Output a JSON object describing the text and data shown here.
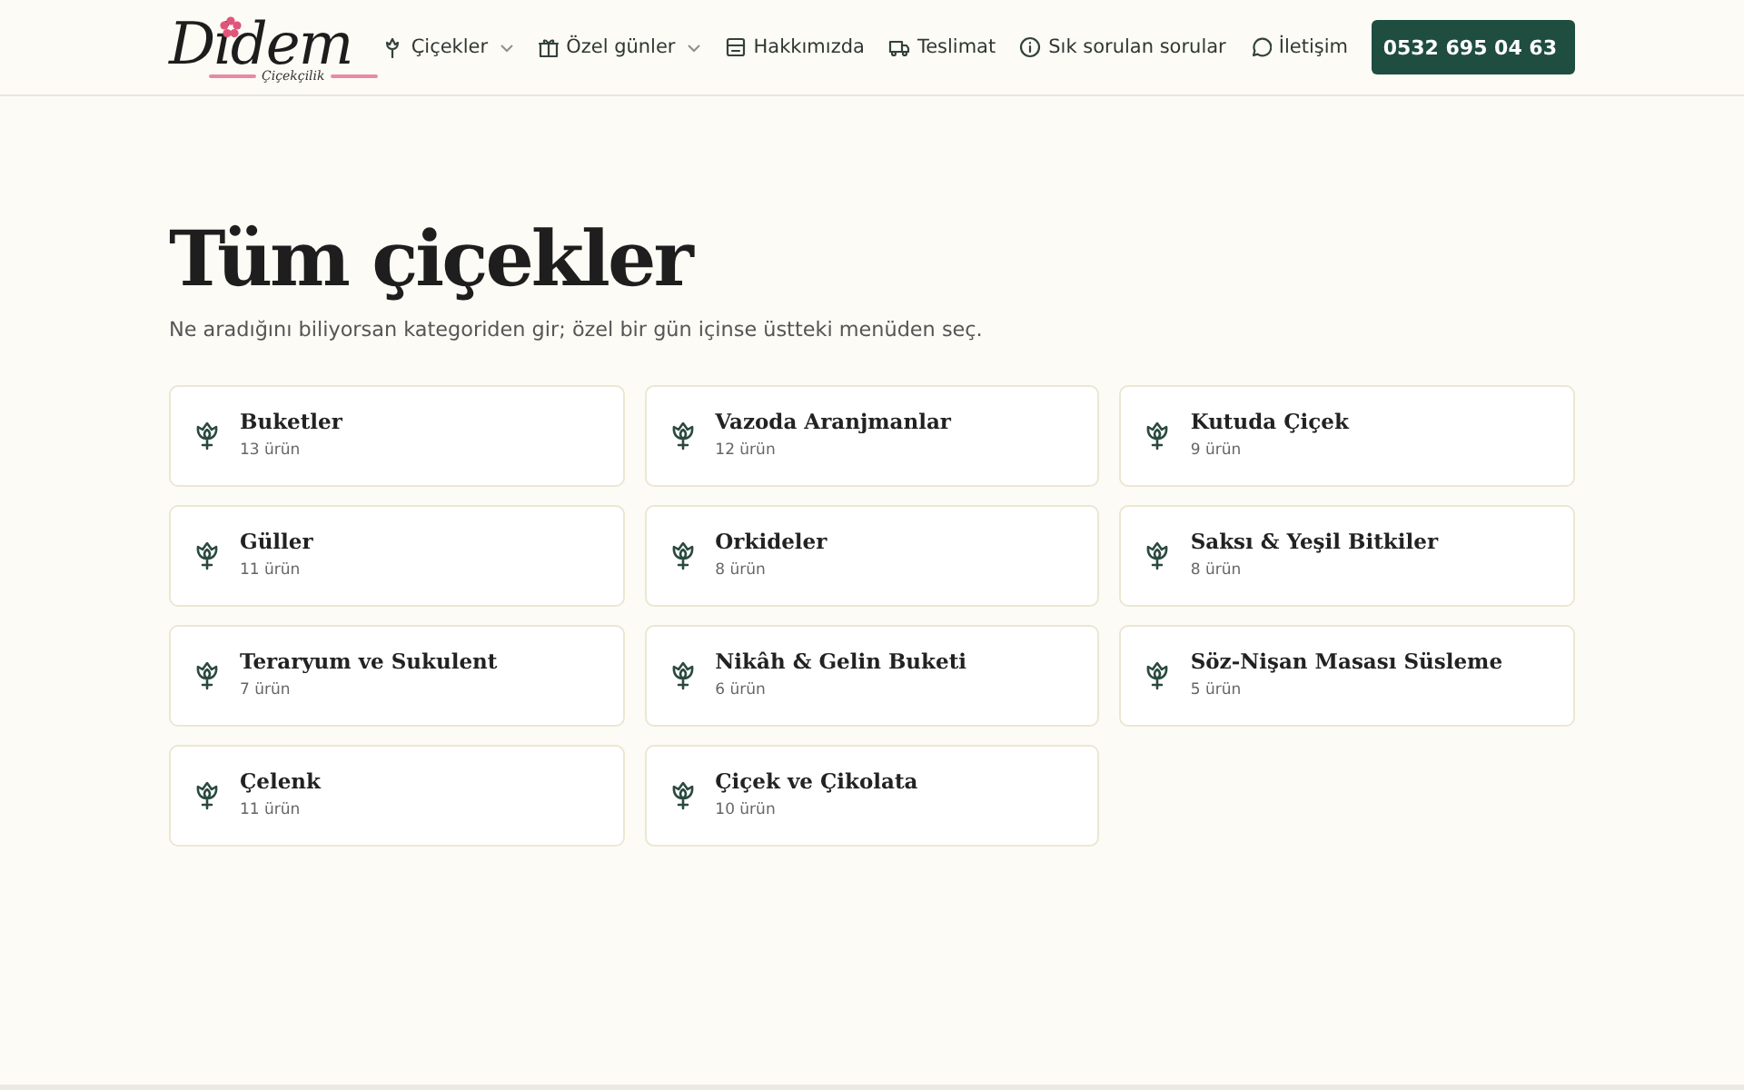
{
  "logo": {
    "name": "Didem",
    "tagline": "Çiçekçilik"
  },
  "nav": [
    {
      "label": "Çiçekler",
      "kind": "flower",
      "dropdown": true
    },
    {
      "label": "Özel günler",
      "kind": "gift",
      "dropdown": true
    },
    {
      "label": "Hakkımızda",
      "kind": "store",
      "dropdown": false
    },
    {
      "label": "Teslimat",
      "kind": "truck",
      "dropdown": false
    },
    {
      "label": "Sık sorulan sorular",
      "kind": "info",
      "dropdown": false
    },
    {
      "label": "İletişim",
      "kind": "chat",
      "dropdown": false
    }
  ],
  "phone_button": "0532 695 04 63",
  "title": "Tüm çiçekler",
  "subtitle": "Ne aradığını biliyorsan kategoriden gir; özel bir gün içinse üstteki menüden seç.",
  "categories": [
    {
      "name": "Buketler",
      "count": "13 ürün"
    },
    {
      "name": "Vazoda Aranjmanlar",
      "count": "12 ürün"
    },
    {
      "name": "Kutuda Çiçek",
      "count": "9 ürün"
    },
    {
      "name": "Güller",
      "count": "11 ürün"
    },
    {
      "name": "Orkideler",
      "count": "8 ürün"
    },
    {
      "name": "Saksı & Yeşil Bitkiler",
      "count": "8 ürün"
    },
    {
      "name": "Teraryum ve Sukulent",
      "count": "7 ürün"
    },
    {
      "name": "Nikâh & Gelin Buketi",
      "count": "6 ürün"
    },
    {
      "name": "Söz-Nişan Masası Süsleme",
      "count": "5 ürün"
    },
    {
      "name": "Çelenk",
      "count": "11 ürün"
    },
    {
      "name": "Çiçek ve Çikolata",
      "count": "10 ürün"
    }
  ]
}
